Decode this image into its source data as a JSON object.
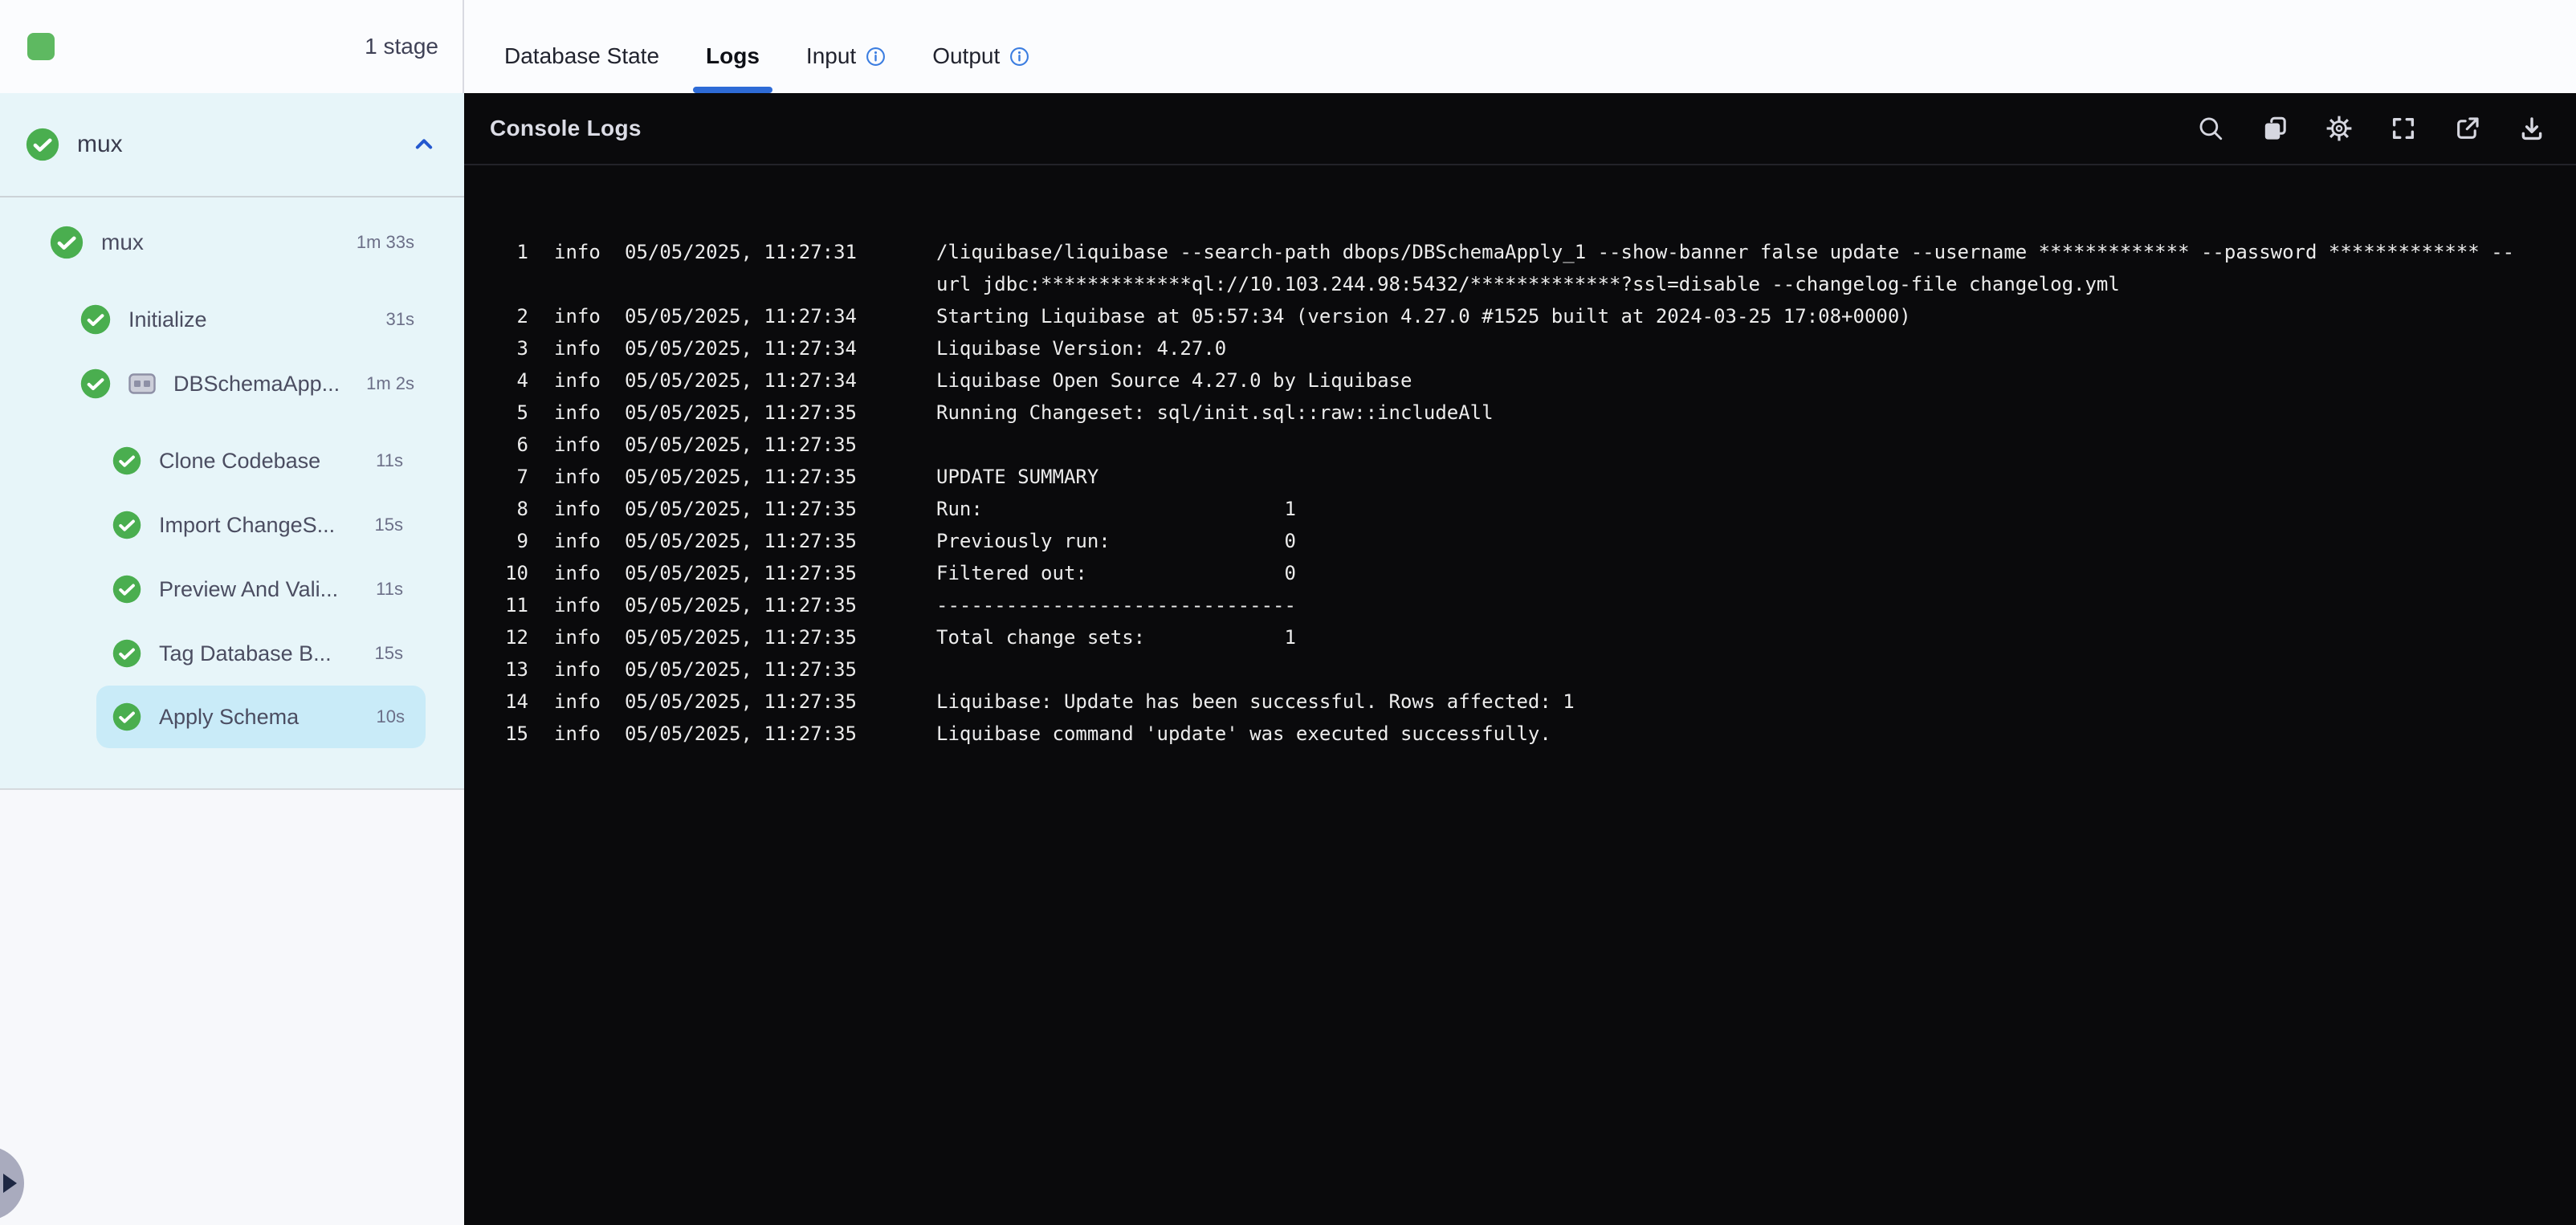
{
  "topbar": {
    "stage_count": "1 stage"
  },
  "tabs": [
    {
      "label": "Database State",
      "active": false,
      "info": false
    },
    {
      "label": "Logs",
      "active": true,
      "info": false
    },
    {
      "label": "Input",
      "active": false,
      "info": true
    },
    {
      "label": "Output",
      "active": false,
      "info": true
    }
  ],
  "sidebar": {
    "stage_name": "mux",
    "tree": [
      {
        "label": "mux",
        "duration": "1m 33s",
        "level": 0,
        "stepgroup": false,
        "selected": false
      },
      {
        "label": "Initialize",
        "duration": "31s",
        "level": 1,
        "stepgroup": false,
        "selected": false
      },
      {
        "label": "DBSchemaApp...",
        "duration": "1m 2s",
        "level": 1,
        "stepgroup": true,
        "selected": false
      },
      {
        "label": "Clone Codebase",
        "duration": "11s",
        "level": 2,
        "stepgroup": false,
        "selected": false
      },
      {
        "label": "Import ChangeS...",
        "duration": "15s",
        "level": 2,
        "stepgroup": false,
        "selected": false
      },
      {
        "label": "Preview And Vali...",
        "duration": "11s",
        "level": 2,
        "stepgroup": false,
        "selected": false
      },
      {
        "label": "Tag Database B...",
        "duration": "15s",
        "level": 2,
        "stepgroup": false,
        "selected": false
      },
      {
        "label": "Apply Schema",
        "duration": "10s",
        "level": 2,
        "stepgroup": false,
        "selected": true
      }
    ]
  },
  "console": {
    "title": "Console Logs",
    "toolbar_icons": [
      "search-icon",
      "copy-icon",
      "settings-icon",
      "fullscreen-icon",
      "open-in-new-icon",
      "download-icon"
    ]
  },
  "floating_button": {
    "icon": "play-icon"
  },
  "logs": [
    {
      "n": 1,
      "level": "info",
      "time": "05/05/2025, 11:27:31",
      "msg": "/liquibase/liquibase --search-path dbops/DBSchemaApply_1 --show-banner false update --username ************* --password ************* --\nurl jdbc:*************ql://10.103.244.98:5432/*************?ssl=disable --changelog-file changelog.yml"
    },
    {
      "n": 2,
      "level": "info",
      "time": "05/05/2025, 11:27:34",
      "msg": "Starting Liquibase at 05:57:34 (version 4.27.0 #1525 built at 2024-03-25 17:08+0000)"
    },
    {
      "n": 3,
      "level": "info",
      "time": "05/05/2025, 11:27:34",
      "msg": "Liquibase Version: 4.27.0"
    },
    {
      "n": 4,
      "level": "info",
      "time": "05/05/2025, 11:27:34",
      "msg": "Liquibase Open Source 4.27.0 by Liquibase"
    },
    {
      "n": 5,
      "level": "info",
      "time": "05/05/2025, 11:27:35",
      "msg": "Running Changeset: sql/init.sql::raw::includeAll"
    },
    {
      "n": 6,
      "level": "info",
      "time": "05/05/2025, 11:27:35",
      "msg": ""
    },
    {
      "n": 7,
      "level": "info",
      "time": "05/05/2025, 11:27:35",
      "msg": "UPDATE SUMMARY"
    },
    {
      "n": 8,
      "level": "info",
      "time": "05/05/2025, 11:27:35",
      "msg": "Run:                          1"
    },
    {
      "n": 9,
      "level": "info",
      "time": "05/05/2025, 11:27:35",
      "msg": "Previously run:               0"
    },
    {
      "n": 10,
      "level": "info",
      "time": "05/05/2025, 11:27:35",
      "msg": "Filtered out:                 0"
    },
    {
      "n": 11,
      "level": "info",
      "time": "05/05/2025, 11:27:35",
      "msg": "-------------------------------"
    },
    {
      "n": 12,
      "level": "info",
      "time": "05/05/2025, 11:27:35",
      "msg": "Total change sets:            1"
    },
    {
      "n": 13,
      "level": "info",
      "time": "05/05/2025, 11:27:35",
      "msg": ""
    },
    {
      "n": 14,
      "level": "info",
      "time": "05/05/2025, 11:27:35",
      "msg": "Liquibase: Update has been successful. Rows affected: 1"
    },
    {
      "n": 15,
      "level": "info",
      "time": "05/05/2025, 11:27:35",
      "msg": "Liquibase command 'update' was executed successfully."
    }
  ],
  "colors": {
    "accent_blue": "#2e6bd6",
    "success_green": "#4aae4f",
    "selected_row_bg": "#c9ebf8",
    "sidebar_bg": "#e7f5f9",
    "log_bg": "#0a0a0c",
    "stage_chip_green": "#5eb961"
  }
}
